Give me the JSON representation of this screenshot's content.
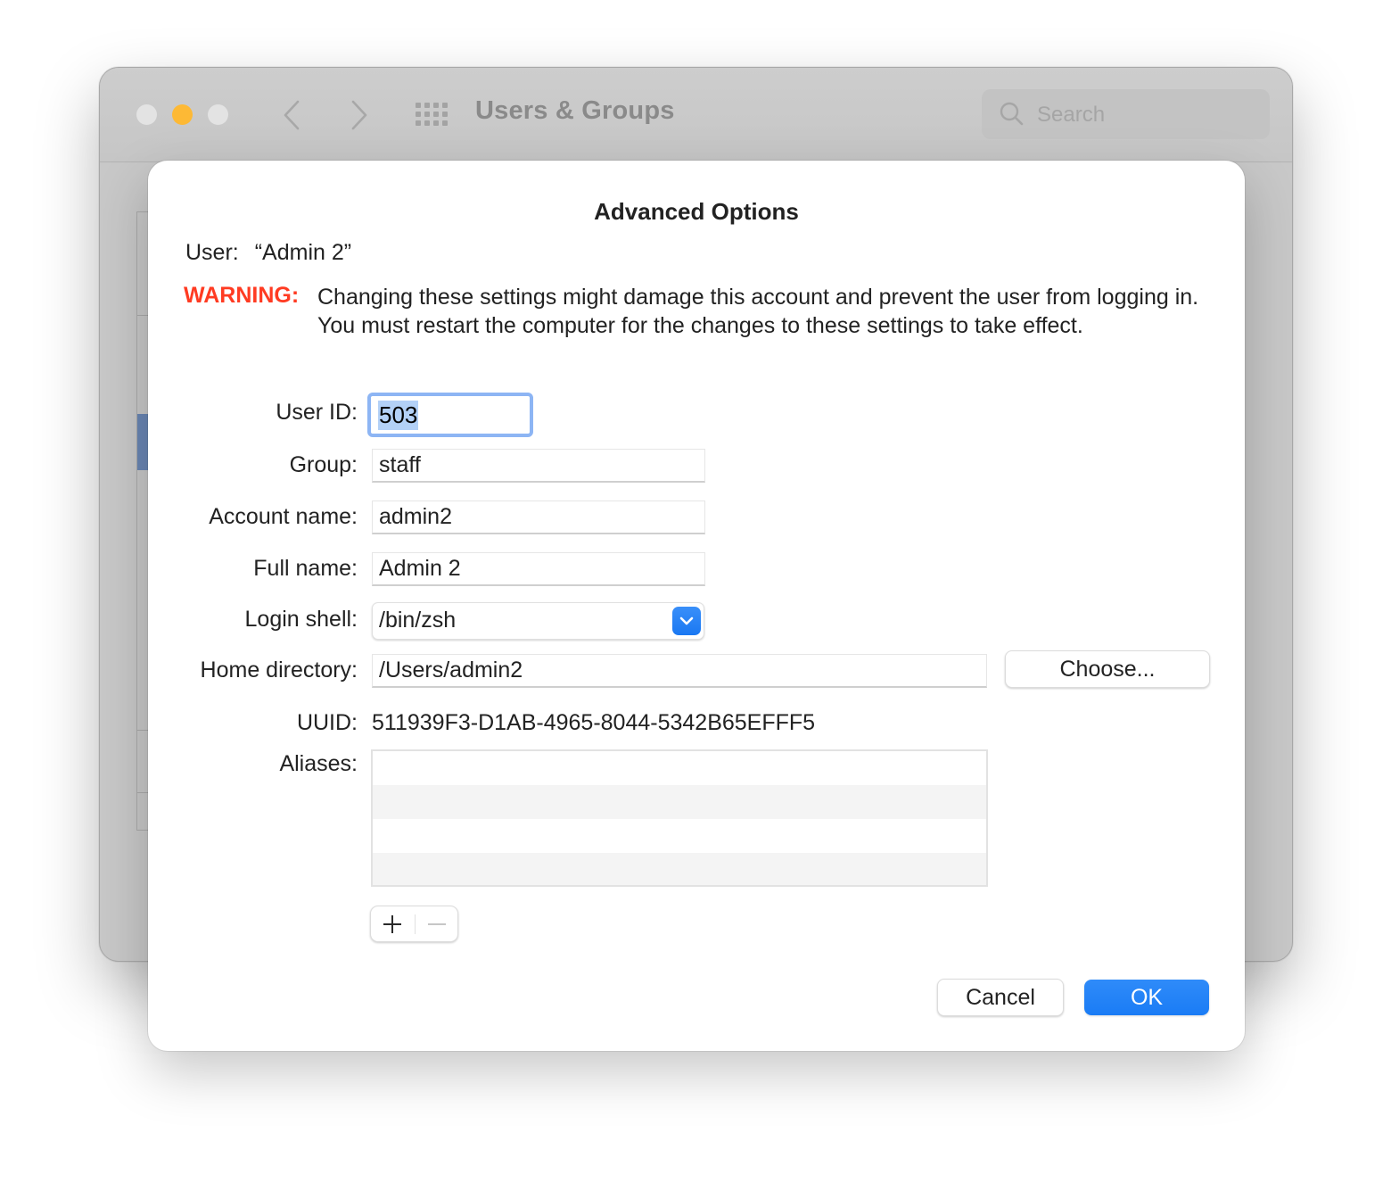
{
  "window": {
    "title": "Users & Groups",
    "search_placeholder": "Search",
    "traffic_lights": {
      "close_color": "#e3e3e3",
      "minimize_color": "#fdb935",
      "zoom_color": "#e3e3e3"
    }
  },
  "dialog": {
    "title": "Advanced Options",
    "user_label": "User:",
    "user_value": "“Admin 2”",
    "warning_label": "WARNING:",
    "warning_color": "#ff3b22",
    "warning_text": "Changing these settings might damage this account and prevent the user from logging in. You must restart the computer for the changes to these settings to take effect.",
    "fields": {
      "user_id": {
        "label": "User ID:",
        "value": "503"
      },
      "group": {
        "label": "Group:",
        "value": "staff"
      },
      "account_name": {
        "label": "Account name:",
        "value": "admin2"
      },
      "full_name": {
        "label": "Full name:",
        "value": "Admin 2"
      },
      "login_shell": {
        "label": "Login shell:",
        "value": "/bin/zsh"
      },
      "home_directory": {
        "label": "Home directory:",
        "value": "/Users/admin2"
      },
      "uuid": {
        "label": "UUID:",
        "value": "511939F3-D1AB-4965-8044-5342B65EFFF5"
      },
      "aliases": {
        "label": "Aliases:",
        "items": []
      }
    },
    "choose_button": "Choose...",
    "add_alias_icon": "plus-icon",
    "remove_alias_icon": "minus-icon",
    "cancel_button": "Cancel",
    "ok_button": "OK",
    "accent_color": "#1a7cf5"
  }
}
